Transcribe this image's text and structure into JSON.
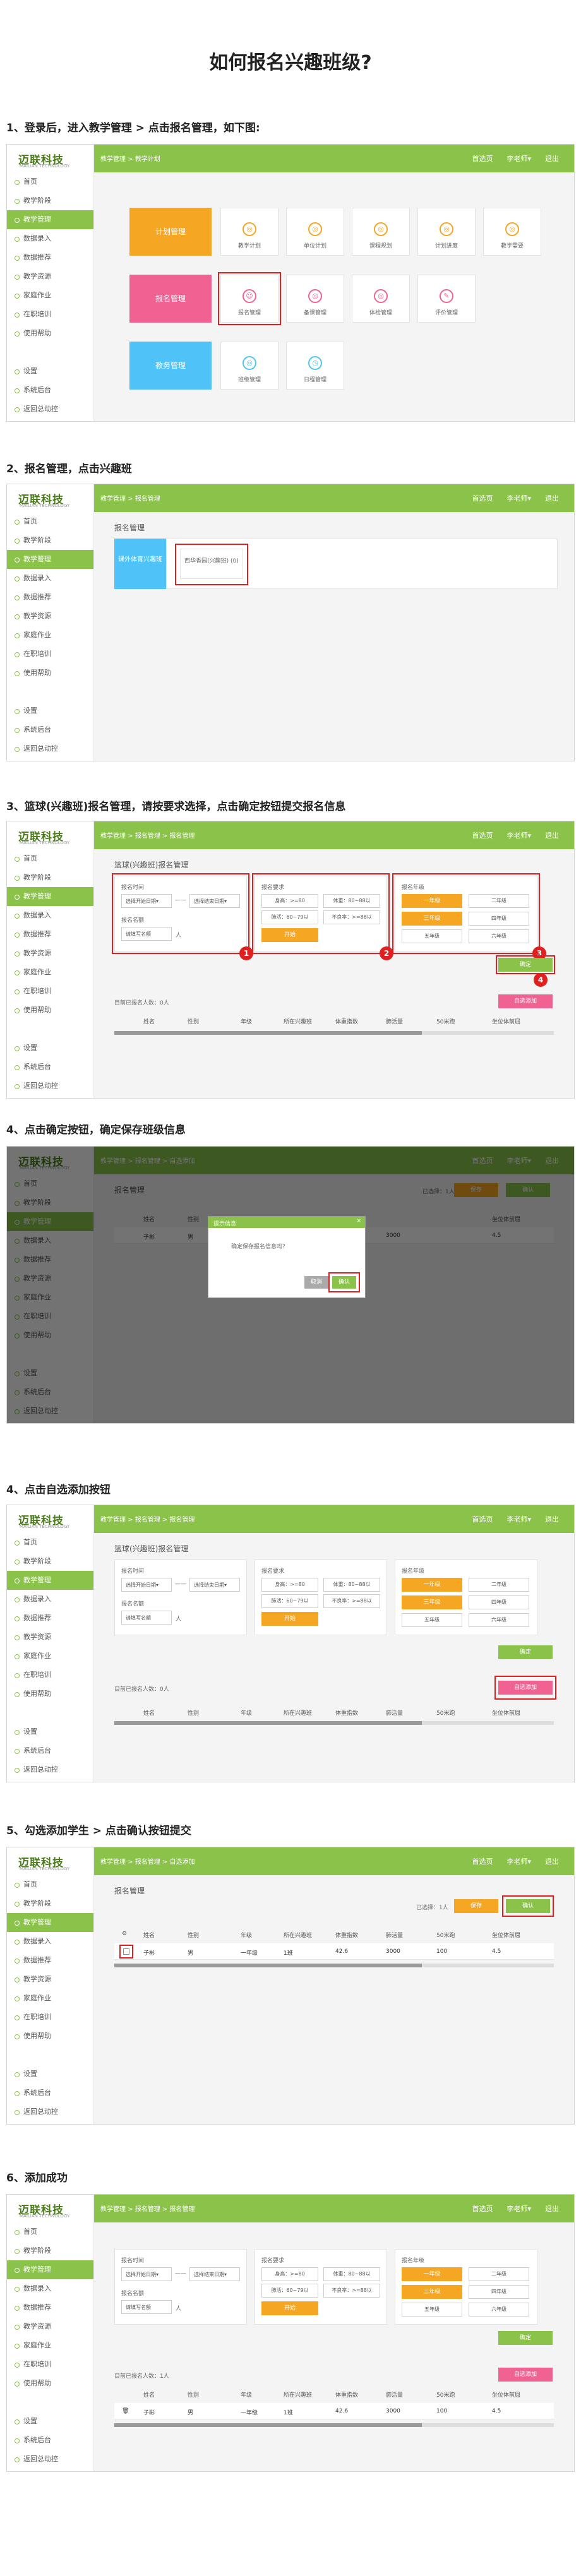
{
  "title": "如何报名兴趣班级?",
  "steps": [
    "1、登录后，进入教学管理 > 点击报名管理，如下图:",
    "2、报名管理，点击兴趣班",
    "3、篮球(兴趣班)报名管理，请按要求选择，点击确定按钮提交报名信息",
    "4、点击确定按钮，确定保存班级信息",
    "4、点击自选添加按钮",
    "5、勾选添加学生 > 点击确认按钮提交",
    "6、添加成功"
  ],
  "app": {
    "logo": "迈联科技",
    "logo_sub": "MAILIAN TECHNOLOGY",
    "nav": {
      "home": "首选页",
      "user": "李老师▾",
      "logout": "退出"
    },
    "menu": [
      "首页",
      "教学阶段",
      "教学管理",
      "数据录入",
      "数据推荐",
      "教学资源",
      "家庭作业",
      "在职培训",
      "使用帮助"
    ],
    "menu2": [
      "设置",
      "系统后台",
      "返回总动控"
    ],
    "bc1": "教学管理 > 教学计划",
    "bc2": "教学管理 > 报名管理",
    "bc3": "教学管理 > 报名管理 > 报名管理",
    "bc4": "教学管理 > 报名管理 > 自选添加"
  },
  "s1": {
    "big": [
      "计划管理",
      "报名管理",
      "教务管理"
    ],
    "row1": [
      "教学计划",
      "单位计划",
      "课程规划",
      "计划进度",
      "教学需要"
    ],
    "row2": [
      "报名管理",
      "备课管理",
      "体检管理",
      "评价管理"
    ],
    "row3": [
      "班级管理",
      "日程管理"
    ]
  },
  "s2": {
    "title": "报名管理",
    "tab": "课外体育兴趣班",
    "item": "西华香园(兴趣班) (0)"
  },
  "s3": {
    "title": "篮球(兴趣班)报名管理",
    "time_label": "报名时间",
    "start": "选择开始日期▾",
    "dash": "——",
    "end": "选择结束日期▾",
    "count_label": "报名名额",
    "count_val": "请填写名额",
    "unit": "人",
    "req_label": "报名要求",
    "reqs": [
      "身高：>=80",
      "体重：80~88以",
      "肺活：60~79以",
      "不良率：>=88以"
    ],
    "req_btn": "开始",
    "grade_label": "报名年级",
    "grades": [
      "一年级",
      "二年级",
      "三年级",
      "四年级",
      "五年级",
      "六年级"
    ],
    "confirm": "确定",
    "add_btn": "自选添加",
    "count_text": "目前已报名人数：0人",
    "count_text2": "目前已报名人数：1人",
    "cols": [
      "",
      "姓名",
      "性别",
      "年级",
      "所在兴趣班",
      "体重指数",
      "肺活量",
      "50米跑",
      "坐位体前屈"
    ],
    "nums": [
      "1",
      "2",
      "3",
      "4"
    ]
  },
  "s4": {
    "dlg_title": "提示信息",
    "dlg_text": "确定保存报名信息吗?",
    "cancel": "取消",
    "ok": "确认",
    "selected": "已选择：1人",
    "save": "保存",
    "ok2": "确认"
  },
  "row": [
    "",
    "子彬",
    "男",
    "一年级",
    "1班",
    "42.6",
    "3000",
    "100",
    "4.5"
  ]
}
